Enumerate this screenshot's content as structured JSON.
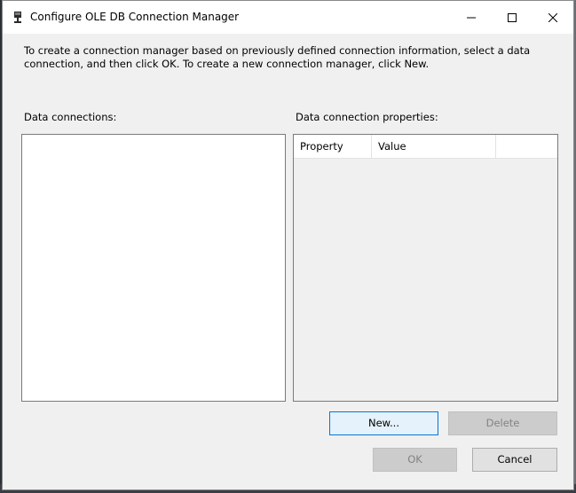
{
  "window": {
    "title": "Configure OLE DB Connection Manager",
    "icon": "connection-plug-icon"
  },
  "instructions": "To create a connection manager based on previously defined connection information, select a data connection, and then click OK. To create a new connection manager, click New.",
  "data_connections": {
    "label": "Data connections:",
    "items": []
  },
  "properties": {
    "label": "Data connection properties:",
    "columns": [
      "Property",
      "Value",
      ""
    ]
  },
  "buttons": {
    "new": "New...",
    "delete": "Delete",
    "ok": "OK",
    "cancel": "Cancel"
  },
  "colors": {
    "accent_border": "#0078d7",
    "disabled_text": "#838383"
  }
}
